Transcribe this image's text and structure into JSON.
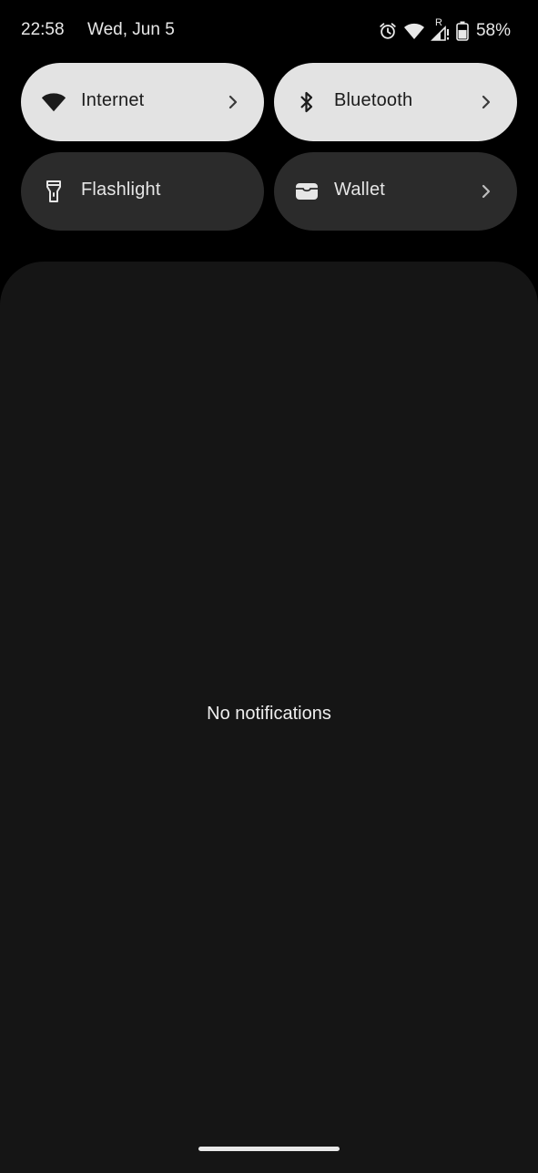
{
  "status_bar": {
    "time": "22:58",
    "date": "Wed, Jun 5",
    "icons": [
      "alarm-icon",
      "wifi-icon",
      "cell-signal-roaming-icon",
      "battery-icon"
    ],
    "roaming_mark": "R",
    "battery_percent": "58%",
    "battery_level": 0.58
  },
  "quick_settings": {
    "tiles": [
      {
        "label": "Internet",
        "state": "on",
        "icon": "wifi-icon",
        "has_chevron": true
      },
      {
        "label": "Bluetooth",
        "state": "on",
        "icon": "bluetooth-icon",
        "has_chevron": true
      },
      {
        "label": "Flashlight",
        "state": "off",
        "icon": "flashlight-icon",
        "has_chevron": false
      },
      {
        "label": "Wallet",
        "state": "off",
        "icon": "wallet-icon",
        "has_chevron": true
      }
    ]
  },
  "notifications": {
    "empty_text": "No notifications"
  },
  "colors": {
    "background": "#000000",
    "panel": "#151515",
    "tile_on": "#e3e3e3",
    "tile_off": "#2b2b2b"
  }
}
